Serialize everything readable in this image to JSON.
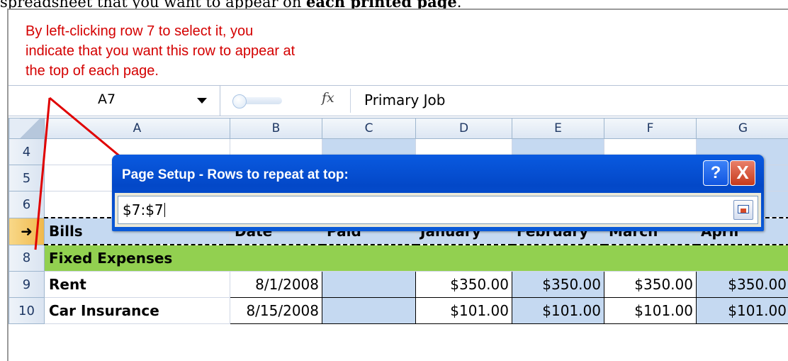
{
  "prose": {
    "before": "spreadsheet that you want to appear on ",
    "bold": "each printed page",
    "after": "."
  },
  "callout": {
    "line1": "By left-clicking row 7 to select it, you",
    "line2": "indicate that you want this row to appear at",
    "line3": "the top of each page.",
    "color": "#d40000"
  },
  "formula_bar": {
    "name_box": "A7",
    "fx_icon": "fx-icon",
    "value": "Primary Job"
  },
  "columns": [
    "A",
    "B",
    "C",
    "D",
    "E",
    "F",
    "G"
  ],
  "rows": {
    "r4": "4",
    "r5": "5",
    "r6": "6",
    "r7_icon": "right-arrow-icon",
    "r8": "8",
    "r9": "9",
    "r10": "10"
  },
  "header_row": [
    "Bills",
    "Date",
    "Paid",
    "January",
    "February",
    "March",
    "April"
  ],
  "fixed_expenses": "Fixed Expenses",
  "rent": {
    "label": "Rent",
    "date": "8/1/2008",
    "paid": "",
    "jan": "$350.00",
    "feb": "$350.00",
    "mar": "$350.00",
    "apr": "$350.00"
  },
  "car_insurance": {
    "label": "Car Insurance",
    "date": "8/15/2008",
    "paid": "",
    "jan": "$101.00",
    "feb": "$101.00",
    "mar": "$101.00",
    "apr": "$101.00"
  },
  "dialog": {
    "title": "Page Setup - Rows to repeat at top:",
    "help": "?",
    "close": "X",
    "input_value": "$7:$7",
    "collapse_icon": "collapse-dialog-icon"
  },
  "colors": {
    "header_fill": "#c5d9f1",
    "fixed_fill": "#92d050",
    "dialog_title": "#0348c8",
    "annotation": "#d40000"
  }
}
